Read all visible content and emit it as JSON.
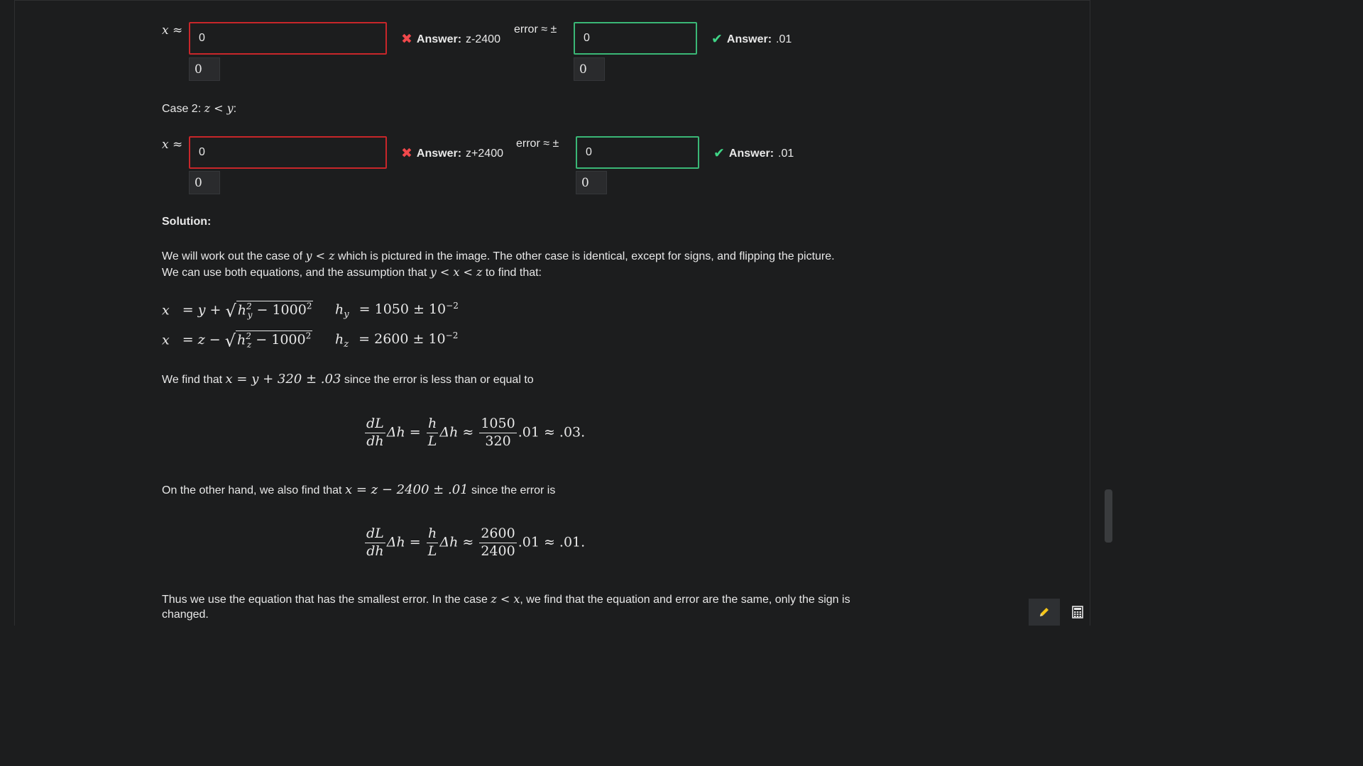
{
  "case1": {
    "x_label": "x ≈",
    "x_value": "0",
    "x_preview": "0",
    "x_feedback_prefix": "Answer:",
    "x_feedback_answer": "z-2400",
    "error_label": "error ≈ ±",
    "error_value": "0",
    "error_preview": "0",
    "error_feedback_prefix": "Answer:",
    "error_feedback_answer": ".01"
  },
  "case2_heading": {
    "prefix": "Case 2: ",
    "math": "z < y",
    "suffix": ":"
  },
  "case2": {
    "x_label": "x ≈",
    "x_value": "0",
    "x_preview": "0",
    "x_feedback_prefix": "Answer:",
    "x_feedback_answer": "z+2400",
    "error_label": "error ≈ ±",
    "error_value": "0",
    "error_preview": "0",
    "error_feedback_prefix": "Answer:",
    "error_feedback_answer": ".01"
  },
  "solution": {
    "heading": "Solution:",
    "p1_a": "We will work out the case of ",
    "p1_m1": "y < z",
    "p1_b": " which is pictured in the image. The other case is identical, except for signs, and flipping the picture.",
    "p2_a": "We can use both equations, and the assumption that ",
    "p2_m1": "y < x < z",
    "p2_b": " to find that:",
    "eq1_lhs": "x",
    "eq1_rhs_a": "= y + ",
    "eq1_rad": "h_y² − 1000²",
    "eq1_h": "h",
    "eq1_h_sub": "y",
    "eq1_h_val": "= 1050 ± 10",
    "eq1_h_exp": "−2",
    "eq2_lhs": "x",
    "eq2_rhs_a": "= z − ",
    "eq2_h": "h",
    "eq2_h_sub": "z",
    "eq2_h_val": "= 2600 ± 10",
    "eq2_h_exp": "−2",
    "p3_a": "We find that ",
    "p3_m": "x = y + 320 ± .03",
    "p3_b": " since the error is less than or equal to",
    "d1_num1": "dL",
    "d1_den1": "dh",
    "d1_mid": "Δh =",
    "d1_num2": "h",
    "d1_den2": "L",
    "d1_mid2": "Δh ≈",
    "d1_num3": "1050",
    "d1_den3": "320",
    "d1_tail": ".01 ≈ .03.",
    "p4_a": "On the other hand, we also find that ",
    "p4_m": "x = z − 2400 ± .01",
    "p4_b": " since the error is",
    "d2_num1": "dL",
    "d2_den1": "dh",
    "d2_mid": "Δh =",
    "d2_num2": "h",
    "d2_den2": "L",
    "d2_mid2": "Δh ≈",
    "d2_num3": "2600",
    "d2_den3": "2400",
    "d2_tail": ".01 ≈ .01.",
    "p5_a": "Thus we use the equation that has the smallest error. In the case ",
    "p5_m": "z < x",
    "p5_b": ", we find that the equation and error are the same, only the sign is",
    "p5_c": "changed."
  },
  "toolbar": {
    "pencil_icon": "pencil-icon",
    "calculator_icon": "calculator-icon",
    "active_color": "#2e3033",
    "pencil_color": "#f5c518"
  }
}
